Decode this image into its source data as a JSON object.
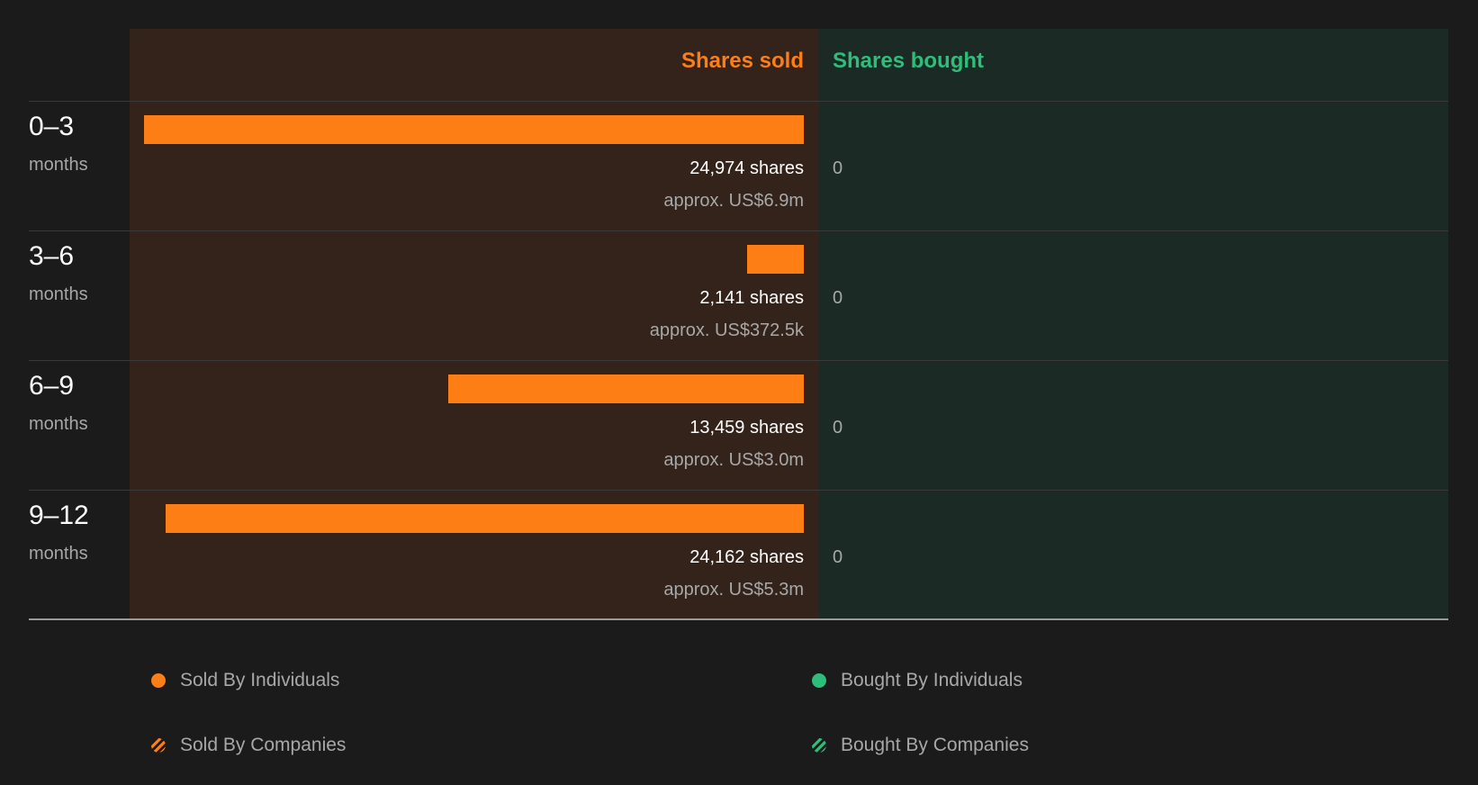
{
  "colors": {
    "sold": "#fd7e14",
    "bought": "#2ebd7a"
  },
  "headers": {
    "sold": "Shares sold",
    "bought": "Shares bought"
  },
  "chart_data": {
    "type": "bar",
    "orientation": "horizontal",
    "categories": [
      "0–3",
      "3–6",
      "6–9",
      "9–12"
    ],
    "category_unit": "months",
    "series": [
      {
        "name": "Shares sold",
        "values": [
          24974,
          2141,
          13459,
          24162
        ],
        "approx": [
          "approx. US$6.9m",
          "approx. US$372.5k",
          "approx. US$3.0m",
          "approx. US$5.3m"
        ]
      },
      {
        "name": "Shares bought",
        "values": [
          0,
          0,
          0,
          0
        ]
      }
    ]
  },
  "rows": [
    {
      "period": "0–3",
      "unit": "months",
      "sold_text": "24,974 shares",
      "sold_value": "approx. US$6.9m",
      "bought_text": "0"
    },
    {
      "period": "3–6",
      "unit": "months",
      "sold_text": "2,141 shares",
      "sold_value": "approx. US$372.5k",
      "bought_text": "0"
    },
    {
      "period": "6–9",
      "unit": "months",
      "sold_text": "13,459 shares",
      "sold_value": "approx. US$3.0m",
      "bought_text": "0"
    },
    {
      "period": "9–12",
      "unit": "months",
      "sold_text": "24,162 shares",
      "sold_value": "approx. US$5.3m",
      "bought_text": "0"
    }
  ],
  "legend": {
    "sold_individuals": "Sold By Individuals",
    "bought_individuals": "Bought By Individuals",
    "sold_companies": "Sold By Companies",
    "bought_companies": "Bought By Companies"
  }
}
